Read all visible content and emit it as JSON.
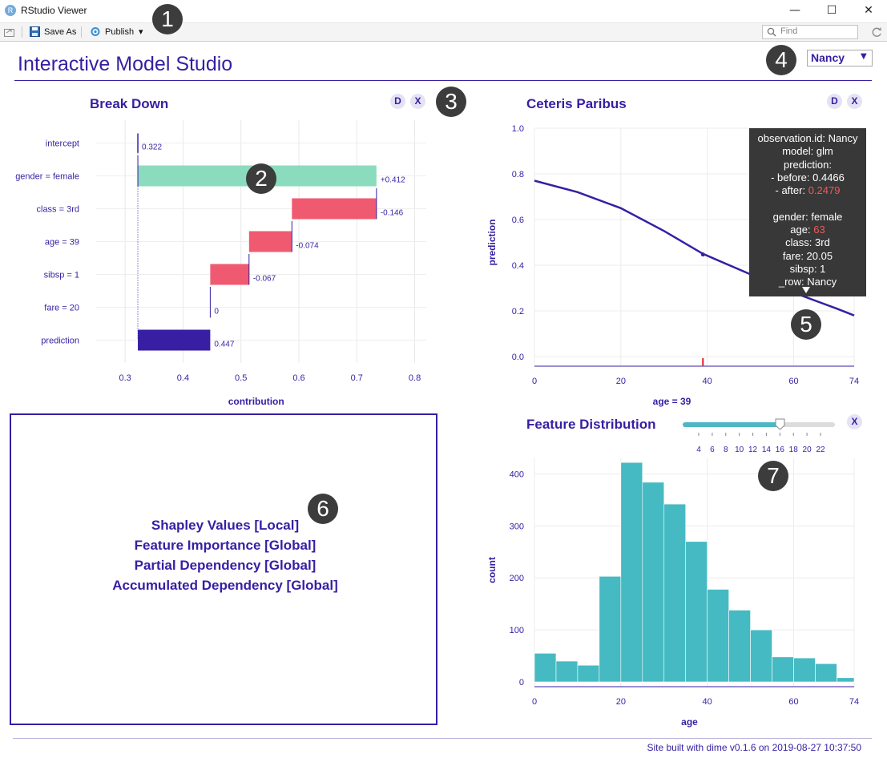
{
  "window": {
    "title": "RStudio Viewer",
    "app_icon_letter": "R",
    "minimize_glyph": "—",
    "maximize_glyph": "☐",
    "close_glyph": "✕"
  },
  "toolbar": {
    "save_as_label": "Save As",
    "publish_label": "Publish",
    "publish_caret": "▾",
    "find_placeholder": "Find"
  },
  "markers": [
    "1",
    "2",
    "3",
    "4",
    "5",
    "6",
    "7"
  ],
  "page": {
    "title": "Interactive Model Studio",
    "observation_select": {
      "value": "Nancy",
      "caret": "▼"
    },
    "footer": "Site built with dime v0.1.6 on 2019-08-27 10:37:50"
  },
  "panels": {
    "break_down": {
      "title": "Break Down",
      "btn_d": "D",
      "btn_x": "X"
    },
    "ceteris_paribus": {
      "title": "Ceteris Paribus",
      "btn_d": "D",
      "btn_x": "X"
    },
    "feature_distribution": {
      "title": "Feature Distribution",
      "btn_x": "X",
      "slider": {
        "value": 16,
        "min": 4,
        "max": 22,
        "ticks": [
          "4",
          "6",
          "8",
          "10",
          "12",
          "14",
          "16",
          "18",
          "20",
          "22"
        ]
      }
    },
    "menu": {
      "items": [
        "Shapley Values [Local]",
        "Feature Importance [Global]",
        "Partial Dependency [Global]",
        "Accumulated Dependency [Global]"
      ]
    }
  },
  "tooltip": {
    "lines": [
      {
        "text": "observation.id: Nancy"
      },
      {
        "text": "model: glm"
      },
      {
        "text": "prediction:"
      },
      {
        "text": "- before: 0.4466"
      },
      {
        "label": "- after: ",
        "value": "0.2479"
      },
      {
        "text": ""
      },
      {
        "text": "gender: female"
      },
      {
        "label": "age: ",
        "value": "63"
      },
      {
        "text": "class: 3rd"
      },
      {
        "text": "fare: 20.05"
      },
      {
        "text": "sibsp: 1"
      },
      {
        "text": "_row: Nancy"
      }
    ],
    "highlight_color": "#f05a5a"
  },
  "colors": {
    "accent": "#371ea3",
    "positive": "#8bdcbe",
    "negative": "#f05a71",
    "prediction": "#371ea3",
    "histogram": "#46bac2",
    "cp_line": "#371ea3",
    "rug": "#e02020"
  },
  "chart_data": [
    {
      "type": "bar",
      "subtype": "waterfall",
      "title": "Break Down",
      "xlabel": "contribution",
      "xlim": [
        0.25,
        0.82
      ],
      "x_ticks": [
        "0.3",
        "0.4",
        "0.5",
        "0.6",
        "0.7",
        "0.8"
      ],
      "grid": true,
      "categories": [
        "intercept",
        "gender = female",
        "class = 3rd",
        "age = 39",
        "sibsp = 1",
        "fare = 20",
        "prediction"
      ],
      "values": [
        0.322,
        0.412,
        -0.146,
        -0.074,
        -0.067,
        0,
        0.447
      ],
      "labels": [
        "0.322",
        "+0.412",
        "-0.146",
        "-0.074",
        "-0.067",
        "0",
        "0.447"
      ]
    },
    {
      "type": "line",
      "title": "Ceteris Paribus",
      "xlabel": "age = 39",
      "ylabel": "prediction",
      "xlim": [
        0,
        74
      ],
      "ylim": [
        0,
        1
      ],
      "x_ticks": [
        "0",
        "20",
        "40",
        "60",
        "74"
      ],
      "y_ticks": [
        "0.0",
        "0.2",
        "0.4",
        "0.6",
        "0.8",
        "1.0"
      ],
      "grid": true,
      "series": [
        {
          "x": [
            0,
            10,
            20,
            30,
            39,
            50,
            60,
            70,
            74
          ],
          "y": [
            0.77,
            0.72,
            0.65,
            0.55,
            0.45,
            0.36,
            0.28,
            0.21,
            0.18
          ]
        }
      ],
      "observation_point": {
        "x": 39,
        "y": 0.447
      },
      "rug_x": 39
    },
    {
      "type": "bar",
      "subtype": "histogram",
      "title": "Feature Distribution",
      "xlabel": "age",
      "ylabel": "count",
      "xlim": [
        0,
        74
      ],
      "ylim": [
        0,
        430
      ],
      "x_ticks": [
        "0",
        "20",
        "40",
        "60",
        "74"
      ],
      "y_ticks": [
        "0",
        "100",
        "200",
        "300",
        "400"
      ],
      "bin_width": 5,
      "bins": [
        {
          "start": 0,
          "end": 5,
          "count": 55
        },
        {
          "start": 5,
          "end": 10,
          "count": 40
        },
        {
          "start": 10,
          "end": 15,
          "count": 32
        },
        {
          "start": 15,
          "end": 20,
          "count": 203
        },
        {
          "start": 20,
          "end": 25,
          "count": 422
        },
        {
          "start": 25,
          "end": 30,
          "count": 384
        },
        {
          "start": 30,
          "end": 35,
          "count": 342
        },
        {
          "start": 35,
          "end": 40,
          "count": 270
        },
        {
          "start": 40,
          "end": 45,
          "count": 178
        },
        {
          "start": 45,
          "end": 50,
          "count": 138
        },
        {
          "start": 50,
          "end": 55,
          "count": 100
        },
        {
          "start": 55,
          "end": 60,
          "count": 48
        },
        {
          "start": 60,
          "end": 65,
          "count": 46
        },
        {
          "start": 65,
          "end": 70,
          "count": 35
        },
        {
          "start": 70,
          "end": 74,
          "count": 8
        }
      ]
    }
  ]
}
